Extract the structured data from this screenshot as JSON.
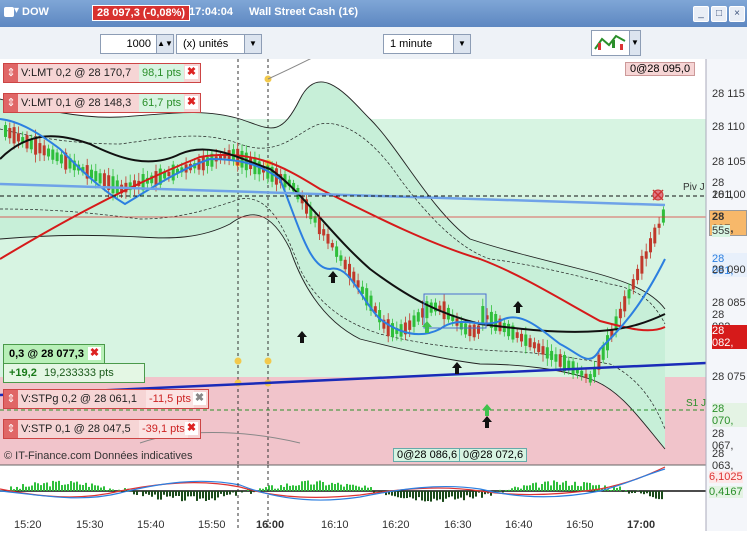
{
  "titlebar": {
    "symbol": "DOW",
    "price_change": "28 097,3 (-0,08%)",
    "time": "17:04:04",
    "instrument": "Wall Street Cash (1€)",
    "buttons": [
      "_",
      "□",
      "×"
    ]
  },
  "toolbar": {
    "quantity": "1000",
    "units": "(x) unités",
    "timeframe": "1 minute"
  },
  "orders": [
    {
      "label": "V:LMT  0,2 @ 28 170,7",
      "pts": "98,1 pts"
    },
    {
      "label": "V:LMT  0,1 @ 28 148,3",
      "pts": "61,7 pts"
    },
    {
      "label": "V:STPg  0,2 @ 28 061,1",
      "pts": "-11,5 pts"
    },
    {
      "label": "V:STP  0,1 @ 28 047,5",
      "pts": "-39,1 pts"
    }
  ],
  "position": {
    "label": "0,3 @ 28 077,3",
    "gain": "+19,2",
    "gain_total": "19,233333 pts"
  },
  "price_axis": {
    "ticks": [
      "28 115",
      "28 110",
      "28 105",
      "28 100",
      "28 095",
      "28 090",
      "28 085",
      "28 080",
      "28 075",
      "28 070",
      "28 065"
    ],
    "last_price": "28 097,",
    "last_price_sub": "55s",
    "extra_1": "28 101,",
    "extra_2": "28 091,",
    "extra_3": "28 082,",
    "extra_4": "28 082,",
    "extra_5": "28 070,",
    "extra_6": "28 067,",
    "extra_7": "28 063,",
    "piv_label": "Piv J",
    "s1_label": "S1 J",
    "top_tag": "0@28 095,0",
    "osc_1": "6,1025",
    "osc_2": "0,4167"
  },
  "bottom_tags": [
    "0@28 086,6",
    "0@28 072,6"
  ],
  "footer": "© IT-Finance.com  Données indicatives",
  "time_axis": [
    "15:20",
    "15:30",
    "15:40",
    "15:50",
    "16:00",
    "16:10",
    "16:20",
    "16:30",
    "16:40",
    "16:50",
    "17:00"
  ],
  "colors": {
    "bull": "#2fbf3b",
    "bear": "#c0392b",
    "band_fill": "#d6f5e3",
    "stop_zone": "#f3c9cf",
    "line_black": "#111111",
    "line_red": "#d61a1a",
    "line_blue": "#2c7fe0",
    "trend_blue": "#1a2bb8",
    "piv_line": "#6fa2e8"
  }
}
